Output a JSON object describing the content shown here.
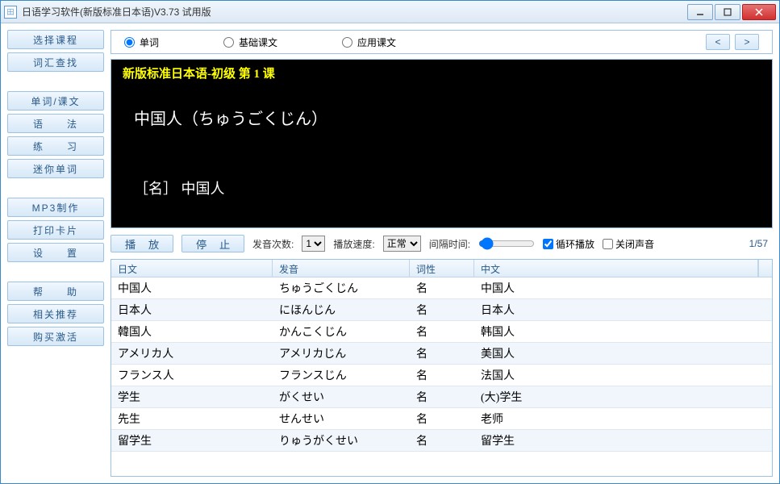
{
  "window": {
    "title": "日语学习软件(新版标准日本语)V3.73 试用版"
  },
  "sidebar": {
    "groups": [
      [
        "选择课程",
        "词汇查找"
      ],
      [
        "单词/课文",
        "语　　法",
        "练　　习",
        "迷你单词"
      ],
      [
        "MP3制作",
        "打印卡片",
        "设　　置"
      ],
      [
        "帮　　助",
        "相关推荐",
        "购买激活"
      ]
    ]
  },
  "radios": {
    "word": "单词",
    "basic": "基础课文",
    "app": "应用课文"
  },
  "display": {
    "lesson": "新版标准日本语-初级 第 1 课",
    "main": "中国人（ちゅうごくじん）",
    "sub": "［名］ 中国人"
  },
  "controls": {
    "play": "播 放",
    "stop": "停 止",
    "count_label": "发音次数:",
    "count_value": "1",
    "speed_label": "播放速度:",
    "speed_value": "正常",
    "interval_label": "间隔时间:",
    "loop": "循环播放",
    "mute": "关闭声音",
    "page": "1/57"
  },
  "table": {
    "headers": {
      "jp": "日文",
      "pron": "发音",
      "pos": "词性",
      "cn": "中文"
    },
    "rows": [
      {
        "jp": "中国人",
        "pron": "ちゅうごくじん",
        "pos": "名",
        "cn": "中国人"
      },
      {
        "jp": "日本人",
        "pron": "にほんじん",
        "pos": "名",
        "cn": "日本人"
      },
      {
        "jp": "韓国人",
        "pron": "かんこくじん",
        "pos": "名",
        "cn": "韩国人"
      },
      {
        "jp": "アメリカ人",
        "pron": "アメリカじん",
        "pos": "名",
        "cn": "美国人"
      },
      {
        "jp": "フランス人",
        "pron": "フランスじん",
        "pos": "名",
        "cn": "法国人"
      },
      {
        "jp": "学生",
        "pron": "がくせい",
        "pos": "名",
        "cn": "(大)学生"
      },
      {
        "jp": "先生",
        "pron": "せんせい",
        "pos": "名",
        "cn": "老师"
      },
      {
        "jp": "留学生",
        "pron": "りゅうがくせい",
        "pos": "名",
        "cn": "留学生"
      }
    ]
  }
}
